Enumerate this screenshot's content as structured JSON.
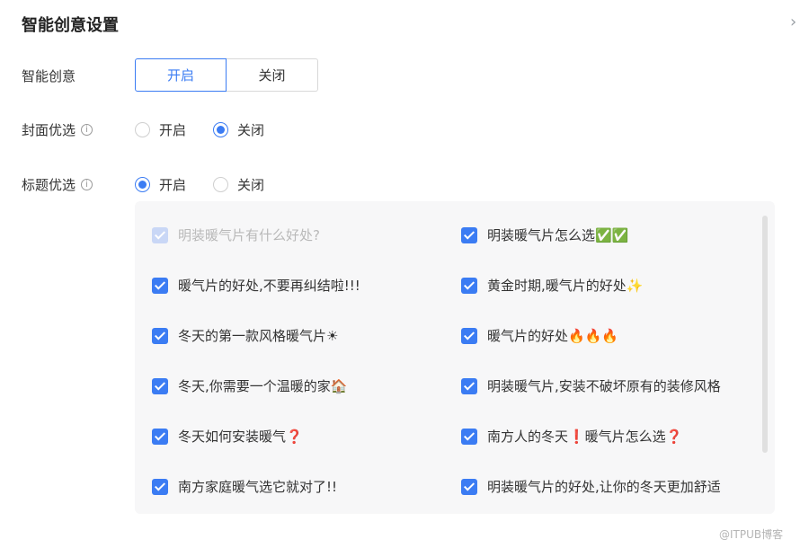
{
  "title": "智能创意设置",
  "rows": {
    "smart": {
      "label": "智能创意",
      "on": "开启",
      "off": "关闭",
      "selected": "on"
    },
    "cover": {
      "label": "封面优选",
      "on": "开启",
      "off": "关闭",
      "selected": "off"
    },
    "headline": {
      "label": "标题优选",
      "on": "开启",
      "off": "关闭",
      "selected": "on"
    }
  },
  "titles": [
    {
      "text": "明装暖气片有什么好处?",
      "checked": true,
      "disabled": true
    },
    {
      "text": "明装暖气片怎么选✅✅",
      "checked": true,
      "disabled": false
    },
    {
      "text": "暖气片的好处,不要再纠结啦!!!",
      "checked": true,
      "disabled": false
    },
    {
      "text": "黄金时期,暖气片的好处✨",
      "checked": true,
      "disabled": false
    },
    {
      "text": "冬天的第一款风格暖气片☀",
      "checked": true,
      "disabled": false
    },
    {
      "text": "暖气片的好处🔥🔥🔥",
      "checked": true,
      "disabled": false
    },
    {
      "text": "冬天,你需要一个温暖的家🏠",
      "checked": true,
      "disabled": false
    },
    {
      "text": "明装暖气片,安装不破坏原有的装修风格",
      "checked": true,
      "disabled": false
    },
    {
      "text": "冬天如何安装暖气❓",
      "checked": true,
      "disabled": false
    },
    {
      "text": "南方人的冬天❗暖气片怎么选❓",
      "checked": true,
      "disabled": false
    },
    {
      "text": "南方家庭暖气选它就对了!!",
      "checked": true,
      "disabled": false
    },
    {
      "text": "明装暖气片的好处,让你的冬天更加舒适",
      "checked": true,
      "disabled": false
    }
  ],
  "watermark": "@ITPUB博客",
  "colors": {
    "accent": "#3b7cf3",
    "panel": "#f7f7f8"
  }
}
